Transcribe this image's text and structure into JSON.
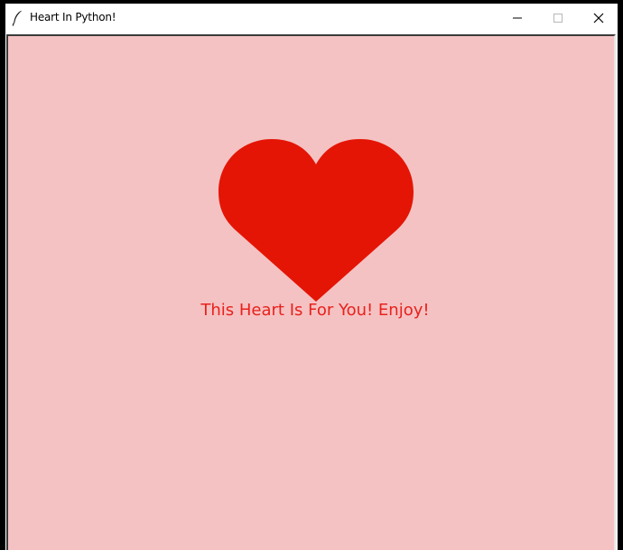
{
  "window": {
    "title": "Heart In Python!",
    "app_icon": "tk-feather-icon",
    "controls": {
      "minimize_icon": "minimize-icon",
      "maximize_icon": "maximize-icon",
      "close_icon": "close-icon"
    }
  },
  "canvas": {
    "background_color": "#f5c2c3",
    "heart_color": "#e41505",
    "caption": "This Heart Is For You! Enjoy!",
    "caption_color": "#e8211c"
  }
}
